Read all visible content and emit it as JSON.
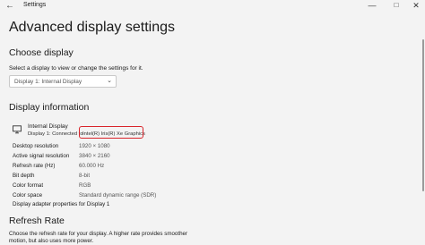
{
  "window": {
    "app_title": "Settings",
    "back_glyph": "←",
    "min_glyph": "—",
    "max_glyph": "□",
    "close_glyph": "✕"
  },
  "page": {
    "title": "Advanced display settings"
  },
  "choose": {
    "heading": "Choose display",
    "subtitle": "Select a display to view or change the settings for it.",
    "selected": "Display 1: Internal Display",
    "chevron": "⌄"
  },
  "info": {
    "heading": "Display information",
    "name": "Internal Display",
    "connected": "Display 1: Connected to",
    "gpu": "Intel(R) Iris(R) Xe Graphics",
    "rows": [
      {
        "label": "Desktop resolution",
        "value": "1920 × 1080"
      },
      {
        "label": "Active signal resolution",
        "value": "3840 × 2160"
      },
      {
        "label": "Refresh rate (Hz)",
        "value": "60.000 Hz"
      },
      {
        "label": "Bit depth",
        "value": "8-bit"
      },
      {
        "label": "Color format",
        "value": "RGB"
      },
      {
        "label": "Color space",
        "value": "Standard dynamic range (SDR)"
      }
    ],
    "adapter_link": "Display adapter properties for Display 1"
  },
  "refresh": {
    "heading": "Refresh Rate",
    "text": "Choose the refresh rate for your display. A higher rate provides smoother motion, but also uses more power."
  }
}
